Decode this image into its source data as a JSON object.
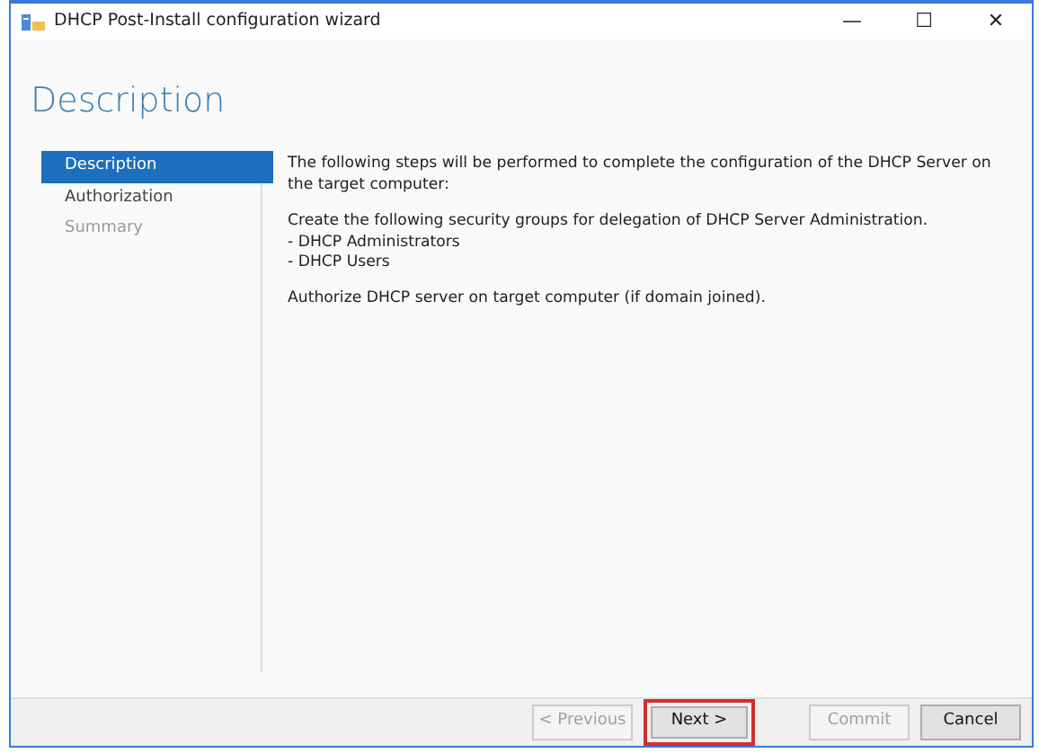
{
  "window": {
    "title": "DHCP Post-Install configuration wizard",
    "controls": [
      "—",
      "☐",
      "✕"
    ]
  },
  "heading": "Description",
  "steps": [
    {
      "label": "Description",
      "selected": true,
      "disabled": false
    },
    {
      "label": "Authorization",
      "selected": false,
      "disabled": false
    },
    {
      "label": "Summary",
      "selected": false,
      "disabled": true
    }
  ],
  "content": {
    "paragraphs": [
      "The following steps will be performed to complete the configuration of the DHCP Server on the target computer:",
      "Create the following security groups for delegation of DHCP Server Administration."
    ],
    "groups": [
      "- DHCP Administrators",
      "- DHCP Users"
    ],
    "note": "Authorize DHCP server on target computer (if domain joined)."
  },
  "buttons": [
    {
      "label": "< Previous",
      "disabled": true,
      "highlighted": false
    },
    {
      "label": "Next >",
      "disabled": false,
      "highlighted": true
    },
    {
      "label": "Commit",
      "disabled": true,
      "highlighted": false
    },
    {
      "label": "Cancel",
      "disabled": false,
      "highlighted": false
    }
  ]
}
